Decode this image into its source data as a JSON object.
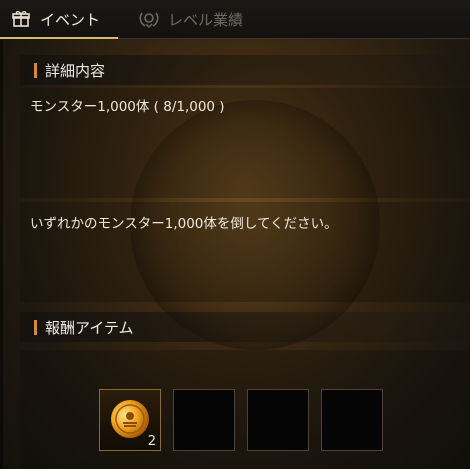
{
  "tabs": [
    {
      "label": "イベント",
      "icon": "gift-icon",
      "active": true
    },
    {
      "label": "レベル業績",
      "icon": "laurel-emblem-icon",
      "active": false
    }
  ],
  "details": {
    "title": "詳細内容",
    "objective": "モンスター1,000体 ( 8/1,000 )",
    "description": "いずれかのモンスター1,000体を倒してください。"
  },
  "rewards": {
    "title": "報酬アイテム",
    "items": [
      {
        "icon": "gold-coin-icon",
        "quantity": "2"
      },
      {
        "icon": "",
        "quantity": ""
      },
      {
        "icon": "",
        "quantity": ""
      },
      {
        "icon": "",
        "quantity": ""
      }
    ]
  },
  "colors": {
    "accent": "#d7883a",
    "tab_underline": "#d9b868"
  }
}
